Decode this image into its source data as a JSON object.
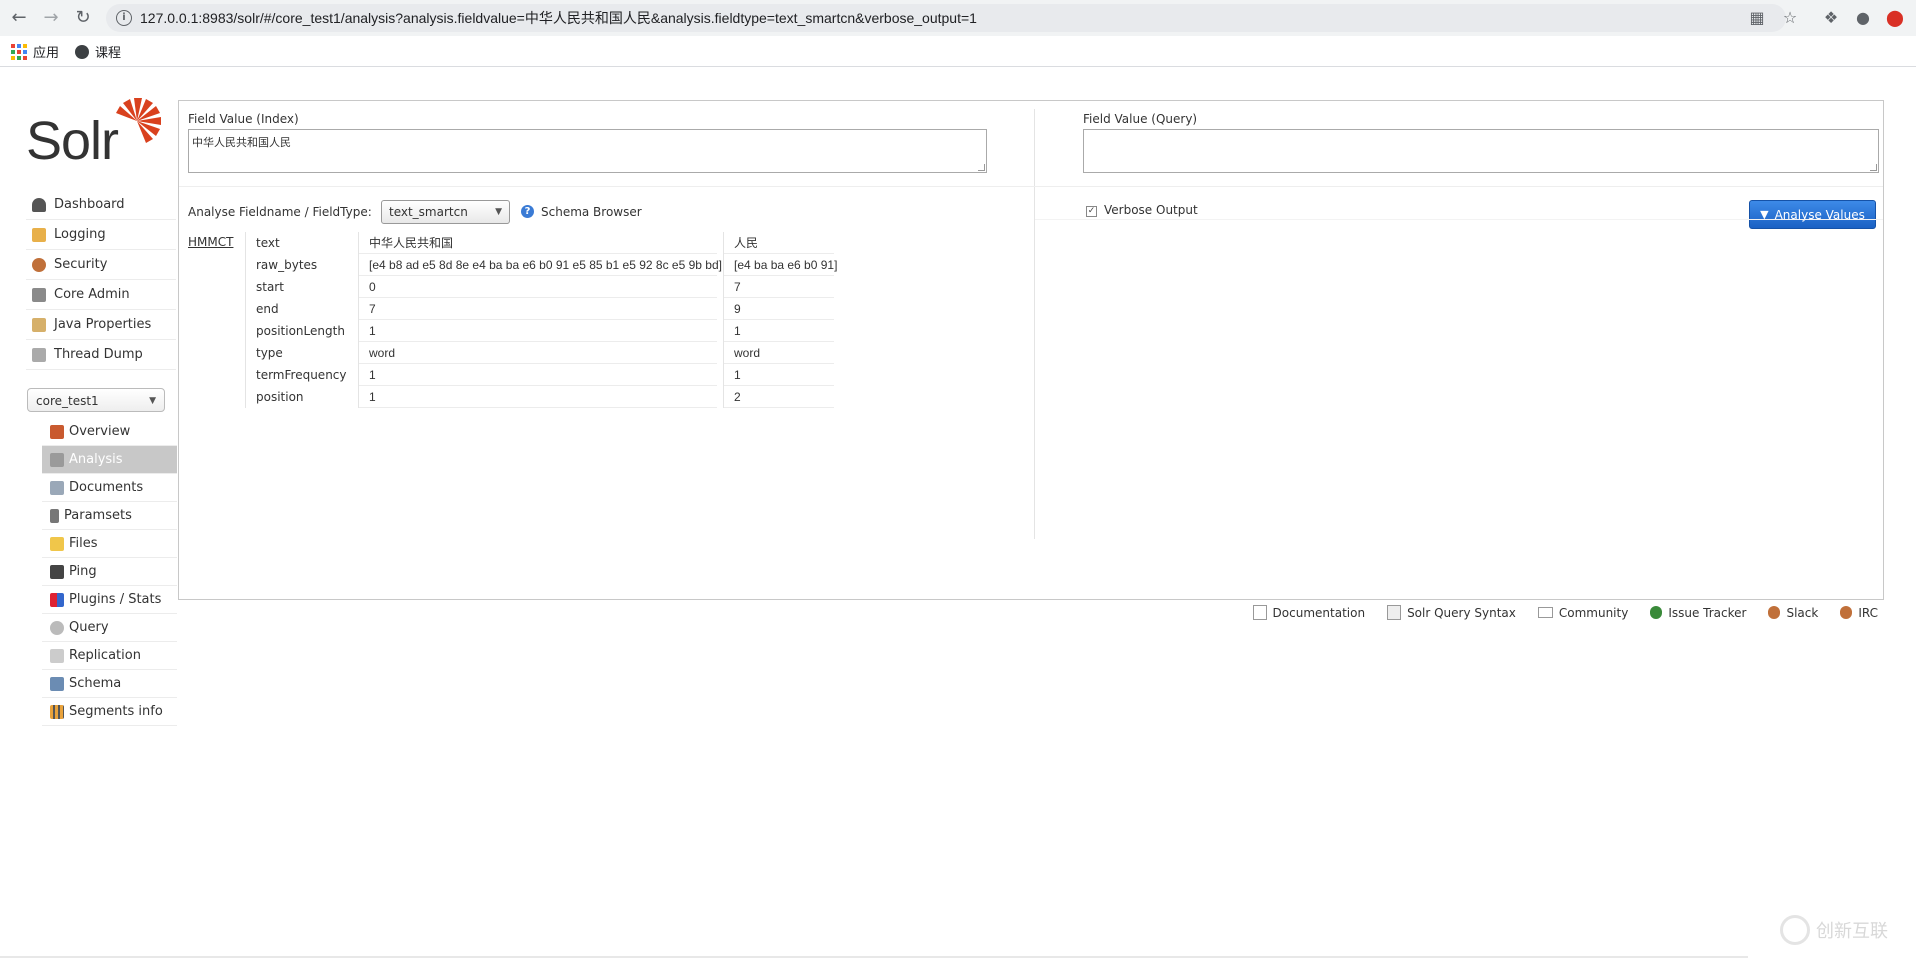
{
  "browser": {
    "url": "127.0.0.1:8983/solr/#/core_test1/analysis?analysis.fieldvalue=中华人民共和国人民&analysis.fieldtype=text_smartcn&verbose_output=1",
    "bookmarks": [
      "应用",
      "课程"
    ]
  },
  "logo": {
    "text": "Solr",
    "accent_color": "#d9411e"
  },
  "menu": [
    {
      "label": "Dashboard",
      "icon": "dashboard-icon"
    },
    {
      "label": "Logging",
      "icon": "logging-icon"
    },
    {
      "label": "Security",
      "icon": "security-icon"
    },
    {
      "label": "Core Admin",
      "icon": "core-admin-icon"
    },
    {
      "label": "Java Properties",
      "icon": "java-properties-icon"
    },
    {
      "label": "Thread Dump",
      "icon": "thread-dump-icon"
    }
  ],
  "core_selector": {
    "value": "core_test1"
  },
  "core_menu": [
    {
      "label": "Overview",
      "icon": "home-icon"
    },
    {
      "label": "Analysis",
      "icon": "funnel-icon",
      "active": true
    },
    {
      "label": "Documents",
      "icon": "documents-icon"
    },
    {
      "label": "Paramsets",
      "icon": "paramsets-icon"
    },
    {
      "label": "Files",
      "icon": "folder-icon"
    },
    {
      "label": "Ping",
      "icon": "ping-icon"
    },
    {
      "label": "Plugins / Stats",
      "icon": "plugins-icon"
    },
    {
      "label": "Query",
      "icon": "magnifier-icon"
    },
    {
      "label": "Replication",
      "icon": "replication-icon"
    },
    {
      "label": "Schema",
      "icon": "schema-icon"
    },
    {
      "label": "Segments info",
      "icon": "segments-icon"
    }
  ],
  "analysis": {
    "index_label": "Field Value (Index)",
    "index_value": "中华人民共和国人民",
    "query_label": "Field Value (Query)",
    "query_value": "",
    "fieldtype_label": "Analyse Fieldname / FieldType:",
    "fieldtype_value": "text_smartcn",
    "schema_browser": "Schema Browser",
    "verbose_label": "Verbose Output",
    "verbose_checked": true,
    "analyse_button": "Analyse Values"
  },
  "results": {
    "tokenizer": "HMMCT",
    "attributes": [
      "text",
      "raw_bytes",
      "start",
      "end",
      "positionLength",
      "type",
      "termFrequency",
      "position"
    ],
    "tokens": [
      [
        "中华人民共和国",
        "[e4 b8 ad e5 8d 8e e4 ba ba e6 b0 91 e5 85 b1 e5 92 8c e5 9b bd]",
        "0",
        "7",
        "1",
        "word",
        "1",
        "1"
      ],
      [
        "人民",
        "[e4 ba ba e6 b0 91]",
        "7",
        "9",
        "1",
        "word",
        "1",
        "2"
      ]
    ]
  },
  "footer": [
    {
      "label": "Documentation",
      "icon": "documentation-icon"
    },
    {
      "label": "Solr Query Syntax",
      "icon": "query-syntax-icon"
    },
    {
      "label": "Community",
      "icon": "community-icon"
    },
    {
      "label": "Issue Tracker",
      "icon": "bug-icon"
    },
    {
      "label": "Slack",
      "icon": "slack-icon"
    },
    {
      "label": "IRC",
      "icon": "irc-icon"
    }
  ],
  "watermark": "创新互联"
}
